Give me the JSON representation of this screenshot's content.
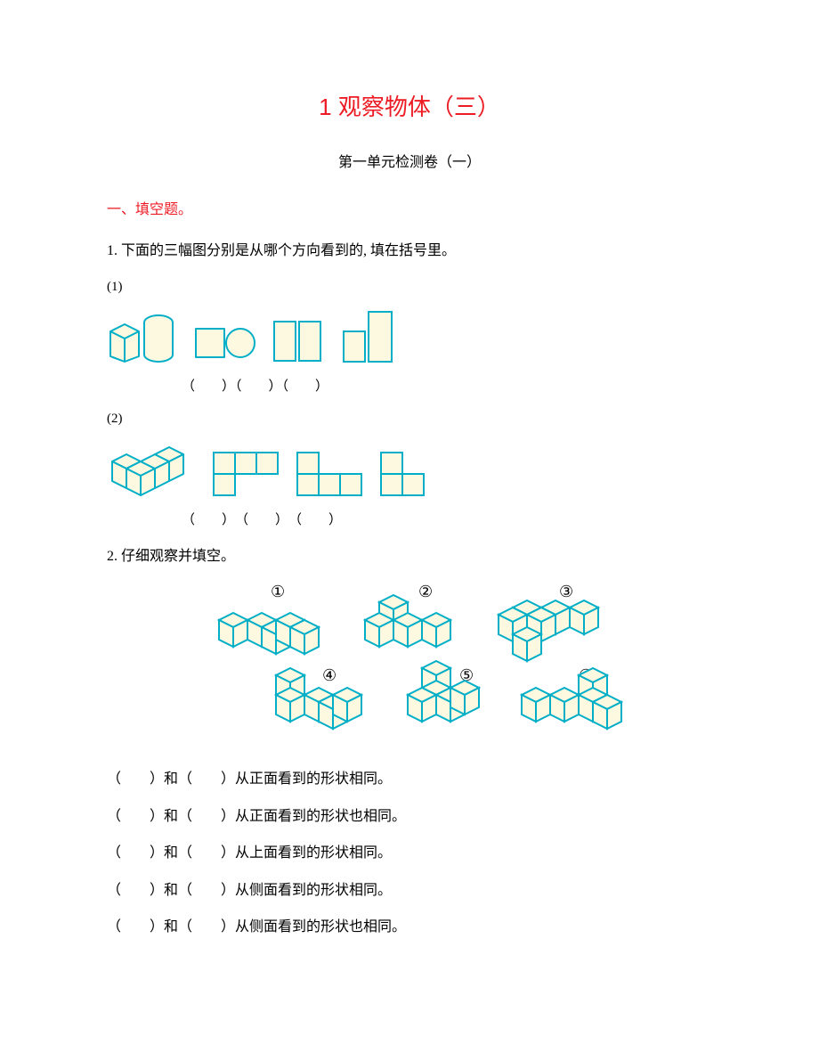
{
  "title": "1 观察物体（三）",
  "subtitle": "第一单元检测卷（一）",
  "section1": "一、填空题。",
  "q1": "1. 下面的三幅图分别是从哪个方向看到的, 填在括号里。",
  "q1_sub1": "(1)",
  "q1_sub2": "(2)",
  "paren_row1": "（　　）（　　）（　　）",
  "paren_row2": "（　　）　（　　）　（　　）",
  "q2": "2. 仔细观察并填空。",
  "labels": {
    "n1": "①",
    "n2": "②",
    "n3": "③",
    "n4": "④",
    "n5": "⑤",
    "n6": "⑥"
  },
  "fills": {
    "f1": "（　　）和（　　）从正面看到的形状相同。",
    "f2": "（　　）和（　　）从正面看到的形状也相同。",
    "f3": "（　　）和（　　）从上面看到的形状相同。",
    "f4": "（　　）和（　　）从侧面看到的形状相同。",
    "f5": "（　　）和（　　）从侧面看到的形状也相同。"
  }
}
